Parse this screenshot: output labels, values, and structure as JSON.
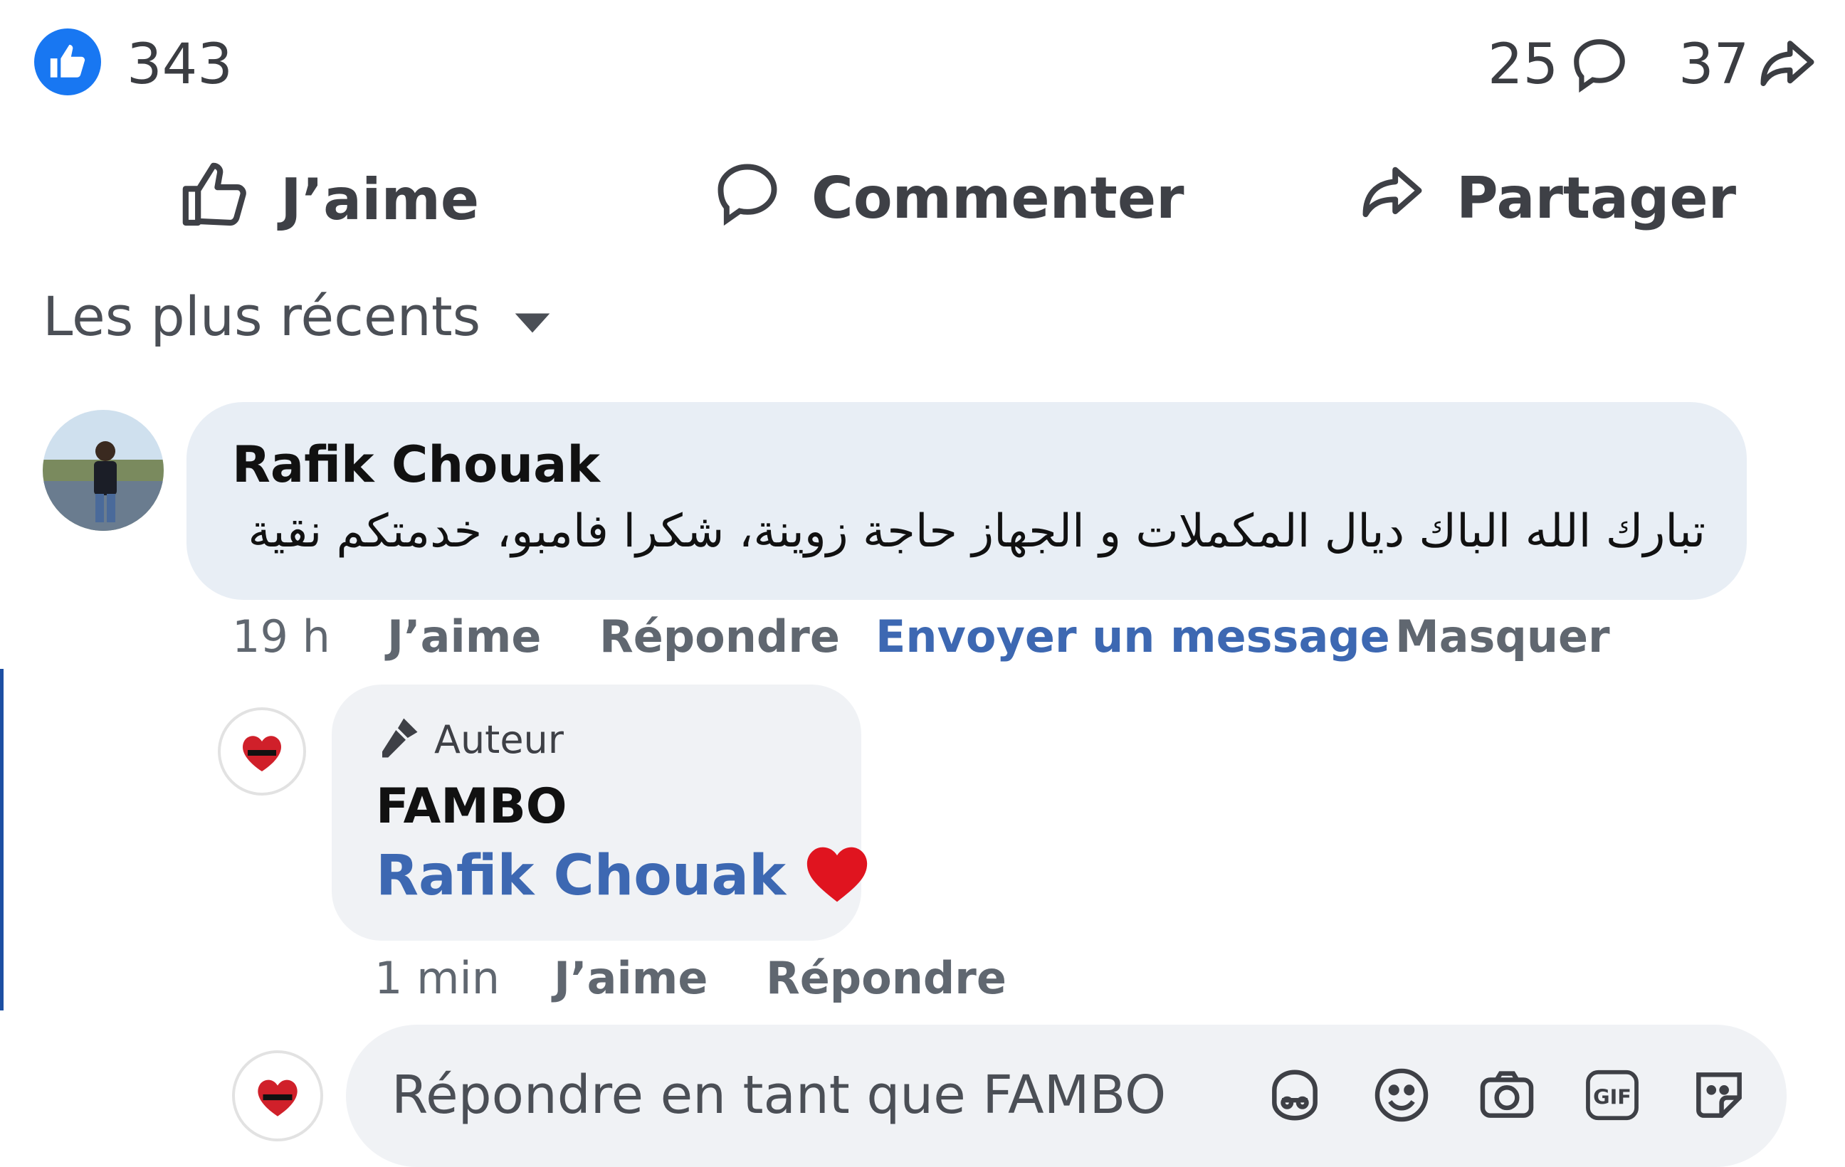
{
  "reactions": {
    "like_count": "343",
    "comment_count": "25",
    "share_count": "37"
  },
  "actions": {
    "like": "J’aime",
    "comment": "Commenter",
    "share": "Partager"
  },
  "sort": {
    "label": "Les plus récents"
  },
  "comment": {
    "author": "Rafik Chouak",
    "text": "تبارك الله الباك ديال المكملات و الجهاز حاجة زوينة، شكرا فامبو، خدمتكم نقية",
    "time": "19 h",
    "like": "J’aime",
    "reply": "Répondre",
    "message": "Envoyer un message",
    "hide": "Masquer"
  },
  "reply": {
    "badge": "Auteur",
    "author": "FAMBO",
    "mention": "Rafik Chouak",
    "time": "1 min",
    "like": "J’aime",
    "reply": "Répondre"
  },
  "composer": {
    "placeholder": "Répondre en tant que FAMBO"
  },
  "colors": {
    "accent": "#1877f2",
    "link": "#3d68b2",
    "heart": "#e0141f"
  }
}
